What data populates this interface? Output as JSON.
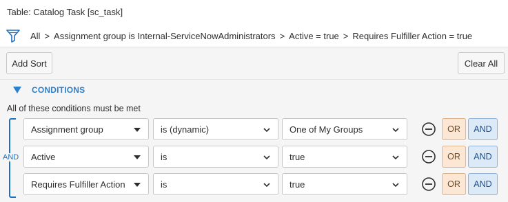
{
  "page": {
    "title": "Table: Catalog Task [sc_task]"
  },
  "breadcrumb": {
    "icon": "filter-icon",
    "items": [
      "All",
      "Assignment group is Internal-ServiceNowAdministrators",
      "Active = true",
      "Requires Fulfiller Action = true"
    ],
    "separator": ">"
  },
  "toolbar": {
    "add_sort_label": "Add Sort",
    "clear_all_label": "Clear All"
  },
  "conditions": {
    "header": "CONDITIONS",
    "must_be_met_text": "All of these conditions must be met",
    "group_operator": "AND",
    "accent_color": "#1f6fbf",
    "rows": [
      {
        "field": "Assignment group",
        "operator": "is (dynamic)",
        "value": "One of My Groups",
        "or_label": "OR",
        "and_label": "AND"
      },
      {
        "field": "Active",
        "operator": "is",
        "value": "true",
        "or_label": "OR",
        "and_label": "AND"
      },
      {
        "field": "Requires Fulfiller Action",
        "operator": "is",
        "value": "true",
        "or_label": "OR",
        "and_label": "AND"
      }
    ]
  }
}
